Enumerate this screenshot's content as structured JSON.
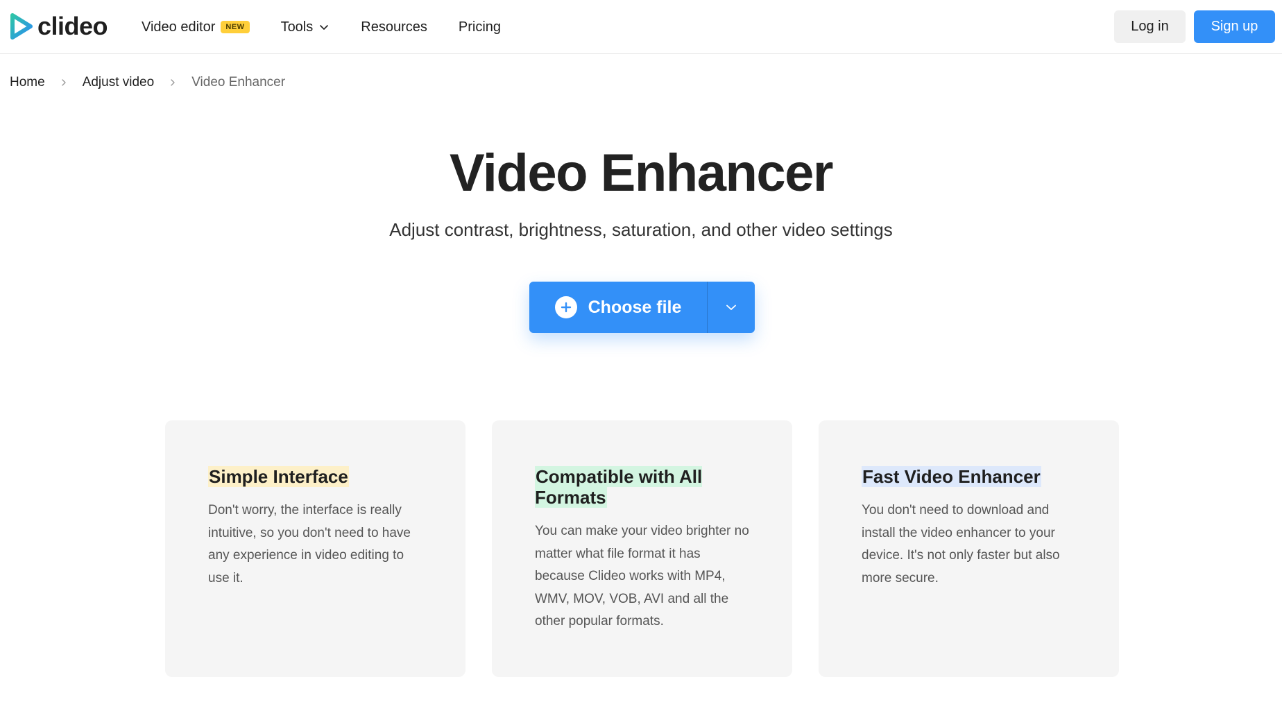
{
  "header": {
    "logo_text": "clideo",
    "nav": [
      {
        "label": "Video editor",
        "badge": "NEW"
      },
      {
        "label": "Tools"
      },
      {
        "label": "Resources"
      },
      {
        "label": "Pricing"
      }
    ],
    "login_label": "Log in",
    "signup_label": "Sign up"
  },
  "breadcrumb": [
    "Home",
    "Adjust video",
    "Video Enhancer"
  ],
  "hero": {
    "title": "Video Enhancer",
    "subtitle": "Adjust contrast, brightness, saturation, and other video settings",
    "choose_file_label": "Choose file"
  },
  "cards": [
    {
      "title": "Simple Interface",
      "text": "Don't worry, the interface is really intuitive, so you don't need to have any experience in video editing to use it."
    },
    {
      "title": "Compatible with All Formats",
      "text": "You can make your video brighter no matter what file format it has because Clideo works with MP4, WMV, MOV, VOB, AVI and all the other popular formats."
    },
    {
      "title": "Fast Video Enhancer",
      "text": "You don't need to download and install the video enhancer to your device. It's not only faster but also more secure."
    }
  ],
  "colors": {
    "accent": "#3390f8",
    "badge": "#ffcf3a",
    "highlight_yellow": "#fdf0c8",
    "highlight_green": "#d3f5e1",
    "highlight_blue": "#dde8fb"
  },
  "icons": [
    "clideo-logo-icon",
    "chevron-down-icon",
    "chevron-right-icon",
    "plus-circle-icon"
  ]
}
